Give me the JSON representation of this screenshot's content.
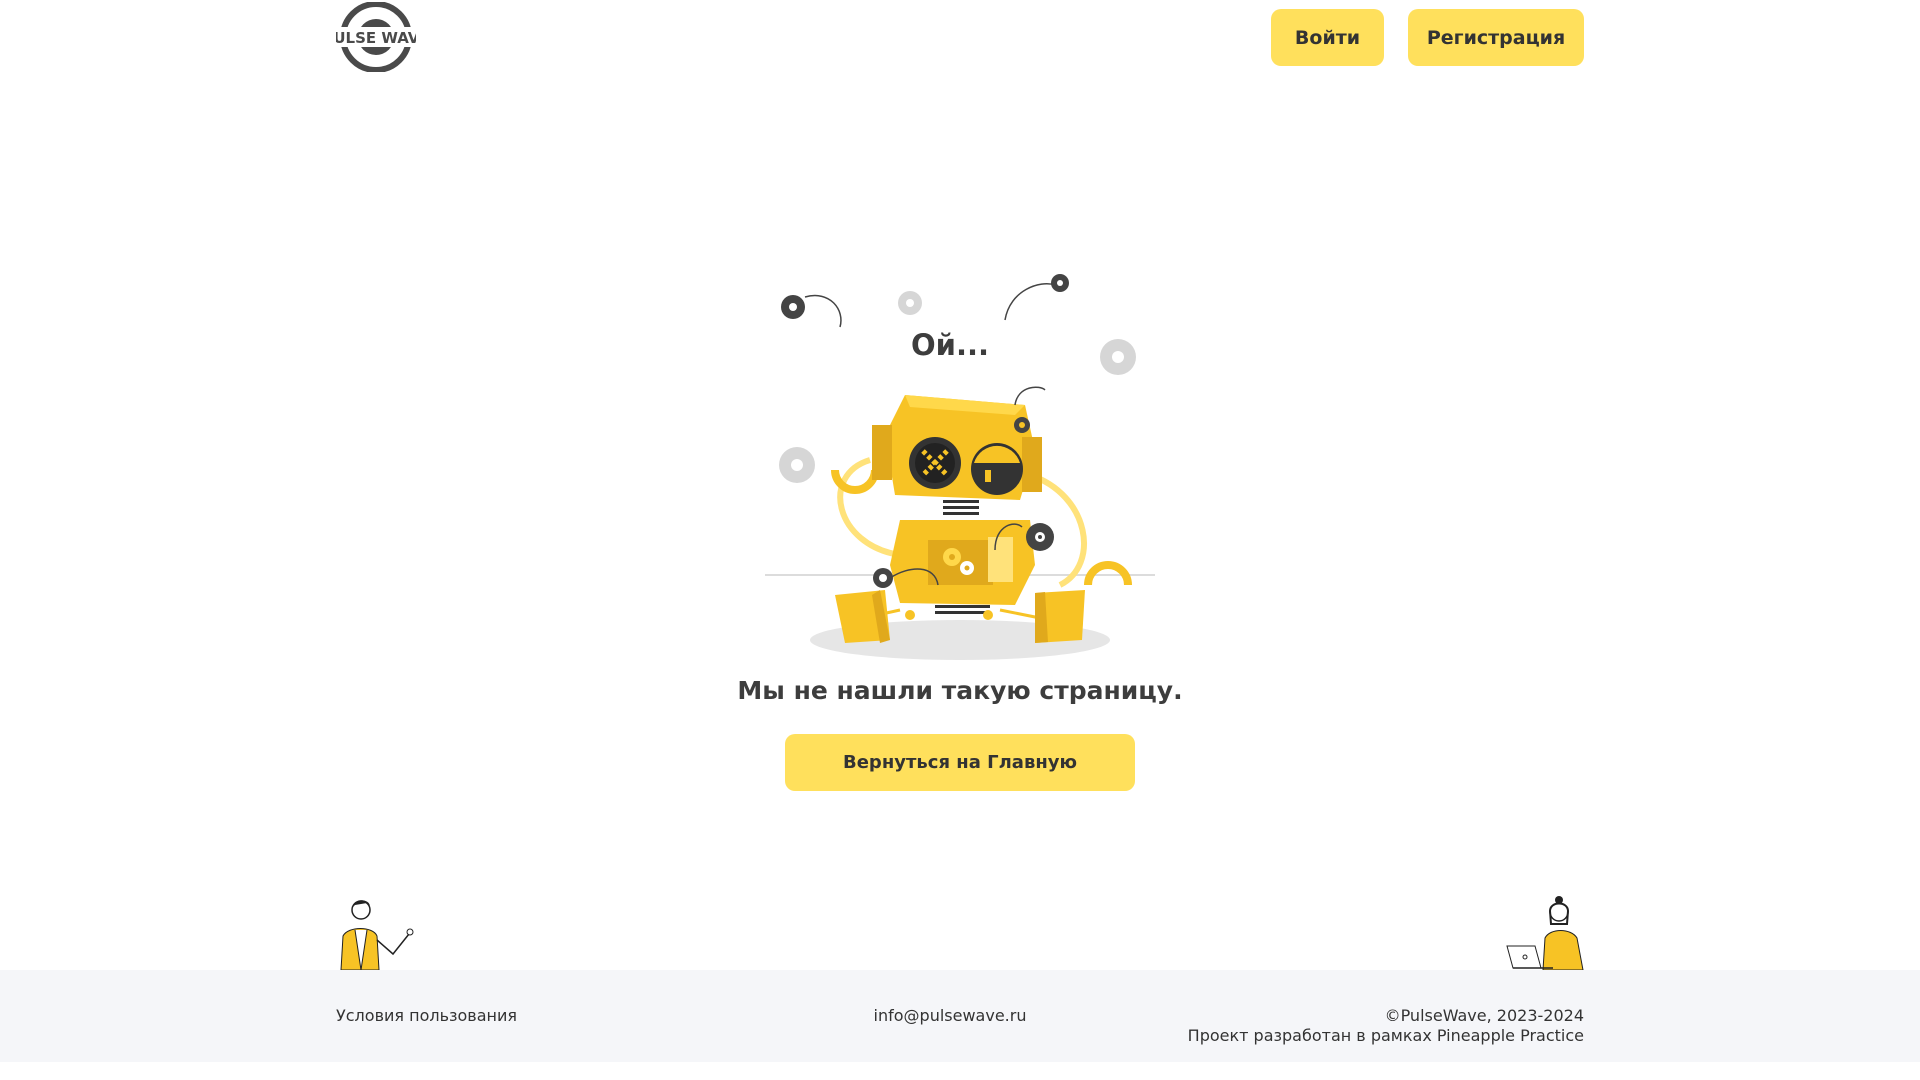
{
  "header": {
    "logo_text": "PULSE WAVE",
    "login_label": "Войти",
    "register_label": "Регистрация"
  },
  "main": {
    "oops": "Ой...",
    "message": "Мы не нашли такую страницу.",
    "home_button_label": "Вернуться на Главную",
    "illustration_icon": "broken-robot-icon"
  },
  "footer": {
    "terms_link": "Условия пользования",
    "email_link": "info@pulsewave.ru",
    "copyright": "©PulseWave, 2023-2024",
    "credits": "Проект разработан в рамках Pineapple Practice"
  },
  "colors": {
    "accent": "#ffe05c",
    "robot_yellow": "#f7c325",
    "text": "#333333",
    "footer_bg": "#f5f6f9"
  }
}
